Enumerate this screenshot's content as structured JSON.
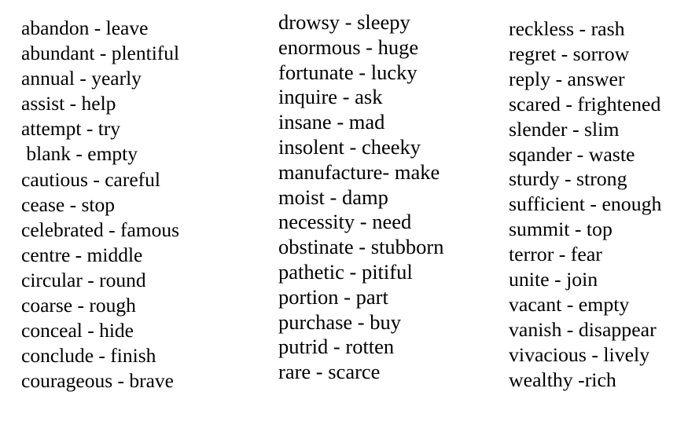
{
  "document": {
    "kind": "synonyms-word-list",
    "background_color": "#ffffff",
    "text_color": "#000000",
    "separator": "-"
  },
  "columns": [
    {
      "id": "column-1",
      "entries": [
        "abandon - leave",
        "abundant - plentiful",
        "annual - yearly",
        "assist - help",
        "attempt - try",
        " blank - empty",
        "cautious - careful",
        "cease - stop",
        "celebrated - famous",
        "centre - middle",
        "circular - round",
        "coarse - rough",
        "conceal - hide",
        "conclude - finish",
        "courageous - brave"
      ]
    },
    {
      "id": "column-2",
      "entries": [
        "drowsy - sleepy",
        "enormous - huge",
        "fortunate - lucky",
        "inquire - ask",
        "insane - mad",
        "insolent - cheeky",
        "manufacture- make",
        "moist - damp",
        "necessity - need",
        "obstinate - stubborn",
        "pathetic - pitiful",
        "portion - part",
        "purchase - buy",
        "putrid - rotten",
        "rare - scarce"
      ]
    },
    {
      "id": "column-3",
      "entries": [
        "reckless - rash",
        "regret - sorrow",
        "reply - answer",
        "scared - frightened",
        "slender - slim",
        "sqander - waste",
        "sturdy - strong",
        "sufficient - enough",
        "summit - top",
        "terror - fear",
        "unite - join",
        "vacant - empty",
        "vanish - disappear",
        "vivacious - lively",
        "wealthy -rich"
      ]
    }
  ]
}
